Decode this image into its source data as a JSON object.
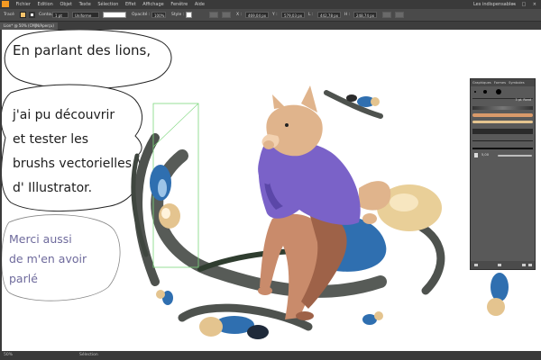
{
  "app": {
    "logo_label": "Ai",
    "menu": [
      "Fichier",
      "Edition",
      "Objet",
      "Texte",
      "Sélection",
      "Effet",
      "Affichage",
      "Fenêtre",
      "Aide"
    ],
    "workspace_label": "Les indispensables",
    "window_controls": "– □ ×"
  },
  "controlbar": {
    "selection_label": "Tracé",
    "stroke_label": "Contour :",
    "stroke_value": "1 pt",
    "profile_value": "Uniforme",
    "opacity_label": "Opacité :",
    "opacity_value": "100%",
    "style_label": "Style :",
    "x_label": "X :",
    "x_value": "469,04 px",
    "y_label": "Y :",
    "y_value": "579,03 px",
    "w_label": "L :",
    "w_value": "442,78 px",
    "h_label": "H :",
    "h_value": "248,74 px"
  },
  "document": {
    "tab_title": "Lion* @ 50% (CMJN/Aperçu)"
  },
  "status": {
    "zoom": "50%",
    "tool_label": "Sélection"
  },
  "bubbles": {
    "top": "En parlant des lions,",
    "middle_lines": [
      "j'ai pu découvrir",
      "et tester les",
      "brushs vectorielles",
      "d' Illustrator."
    ],
    "bottom_lines": [
      "Merci aussi",
      "de m'en avoir",
      "parlé"
    ]
  },
  "panel": {
    "tabs": [
      "Graphiques",
      "Formes",
      "Symboles"
    ],
    "brush_name": "3 pt. Rond",
    "size_value": "5,00"
  },
  "colors": {
    "ui_dark": "#3a3a3a",
    "text_dark": "#1d1d1d",
    "text_purple": "#6e6a9c",
    "hoodie": "#7a62c8",
    "shadow_dark": "#4e524e",
    "blue": "#2f6fb0",
    "selection_green": "#7ed87e"
  },
  "icons": {
    "logo": "illustrator-logo-icon",
    "brush": "brush-icon",
    "panel_menu": "panel-menu-icon"
  }
}
